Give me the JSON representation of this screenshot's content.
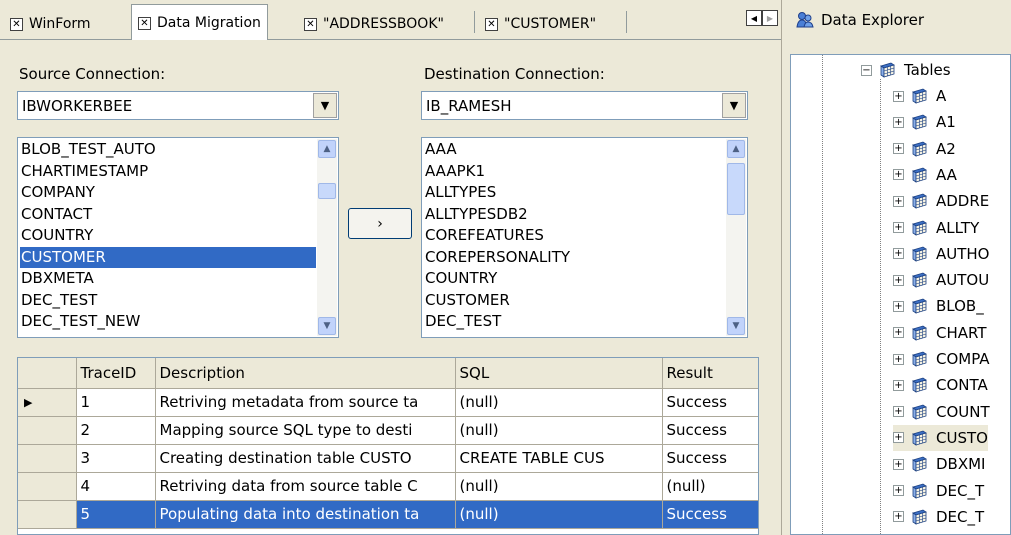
{
  "tabs": [
    {
      "label": "WinForm",
      "active": false
    },
    {
      "label": "Data Migration",
      "active": true
    },
    {
      "label": "\"ADDRESSBOOK\"",
      "active": false
    },
    {
      "label": "\"CUSTOMER\"",
      "active": false
    }
  ],
  "source": {
    "label": "Source Connection:",
    "connection": "IBWORKERBEE",
    "tables": [
      "BLOB_TEST_AUTO",
      "CHARTIMESTAMP",
      "COMPANY",
      "CONTACT",
      "COUNTRY",
      "CUSTOMER",
      "DBXMETA",
      "DEC_TEST",
      "DEC_TEST_NEW"
    ],
    "selected": "CUSTOMER"
  },
  "destination": {
    "label": "Destination Connection:",
    "connection": "IB_RAMESH",
    "tables": [
      "AAA",
      "AAAPK1",
      "ALLTYPES",
      "ALLTYPESDB2",
      "COREFEATURES",
      "COREPERSONALITY",
      "COUNTRY",
      "CUSTOMER",
      "DEC_TEST"
    ]
  },
  "move_button": "›",
  "grid": {
    "columns": [
      "TraceID",
      "Description",
      "SQL",
      "Result"
    ],
    "rows": [
      {
        "id": "1",
        "description": "Retriving metadata from source ta",
        "sql": "(null)",
        "result": "Success"
      },
      {
        "id": "2",
        "description": "Mapping source SQL type to desti",
        "sql": "(null)",
        "result": "Success"
      },
      {
        "id": "3",
        "description": "Creating destination table CUSTO",
        "sql": "CREATE TABLE CUS",
        "result": "Success"
      },
      {
        "id": "4",
        "description": "Retriving data from source table C",
        "sql": "(null)",
        "result": "(null)"
      },
      {
        "id": "5",
        "description": "Populating data into destination ta",
        "sql": "(null)",
        "result": "Success"
      }
    ],
    "current_row_marker": "▶",
    "selected_row": "5"
  },
  "explorer": {
    "title": "Data Explorer",
    "root_label": "Tables",
    "tables": [
      "A",
      "A1",
      "A2",
      "AA",
      "ADDRE",
      "ALLTY",
      "AUTHO",
      "AUTOU",
      "BLOB_",
      "CHART",
      "COMPA",
      "CONTA",
      "COUNT",
      "CUSTO",
      "DBXMI",
      "DEC_T",
      "DEC_T"
    ],
    "selected": "CUSTO"
  }
}
